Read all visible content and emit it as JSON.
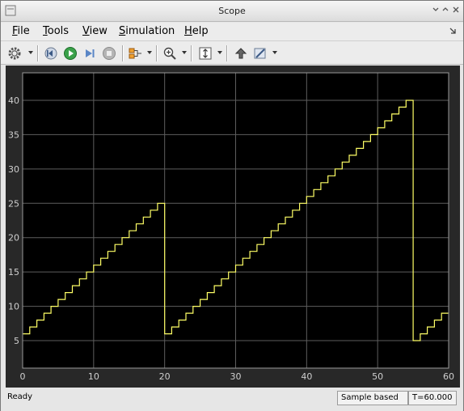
{
  "window": {
    "title": "Scope"
  },
  "menu": [
    {
      "label": "File",
      "mnemonic": "F",
      "rest": "ile"
    },
    {
      "label": "Tools",
      "mnemonic": "T",
      "rest": "ools"
    },
    {
      "label": "View",
      "mnemonic": "V",
      "rest": "iew"
    },
    {
      "label": "Simulation",
      "mnemonic": "S",
      "rest": "imulation"
    },
    {
      "label": "Help",
      "mnemonic": "H",
      "rest": "elp"
    }
  ],
  "toolbar": {
    "icons": [
      "settings-icon",
      "step-back-icon",
      "run-icon",
      "step-forward-icon",
      "stop-icon",
      "signal-selector-icon",
      "zoom-in-icon",
      "autoscale-icon",
      "highlight-block-icon",
      "style-icon"
    ]
  },
  "status": {
    "left": "Ready",
    "mode": "Sample based",
    "time": "T=60.000"
  },
  "colors": {
    "plot_bg": "#000000",
    "frame_bg": "#282828",
    "grid": "#5e5e5e",
    "signal": "#ffff66",
    "tick_text": "#cfcfcf"
  },
  "chart_data": {
    "type": "line",
    "title": "",
    "xlabel": "",
    "ylabel": "",
    "xlim": [
      0,
      60
    ],
    "ylim": [
      1,
      44
    ],
    "xticks": [
      0,
      10,
      20,
      30,
      40,
      50,
      60
    ],
    "yticks": [
      5,
      10,
      15,
      20,
      25,
      30,
      35,
      40
    ],
    "grid": true,
    "step": true,
    "series": [
      {
        "x": [
          0,
          1,
          2,
          3,
          4,
          5,
          6,
          7,
          8,
          9,
          10,
          11,
          12,
          13,
          14,
          15,
          16,
          17,
          18,
          19,
          20,
          21,
          22,
          23,
          24,
          25,
          26,
          27,
          28,
          29,
          30,
          31,
          32,
          33,
          34,
          35,
          36,
          37,
          38,
          39,
          40,
          41,
          42,
          43,
          44,
          45,
          46,
          47,
          48,
          49,
          50,
          51,
          52,
          53,
          54,
          55,
          56,
          57,
          58,
          59,
          60
        ],
        "y": [
          6,
          7,
          8,
          9,
          10,
          11,
          12,
          13,
          14,
          15,
          16,
          17,
          18,
          19,
          20,
          21,
          22,
          23,
          24,
          25,
          6,
          7,
          8,
          9,
          10,
          11,
          12,
          13,
          14,
          15,
          16,
          17,
          18,
          19,
          20,
          21,
          22,
          23,
          24,
          25,
          26,
          27,
          28,
          29,
          30,
          31,
          32,
          33,
          34,
          35,
          36,
          37,
          38,
          39,
          40,
          5,
          6,
          7,
          8,
          9,
          9
        ]
      }
    ]
  }
}
